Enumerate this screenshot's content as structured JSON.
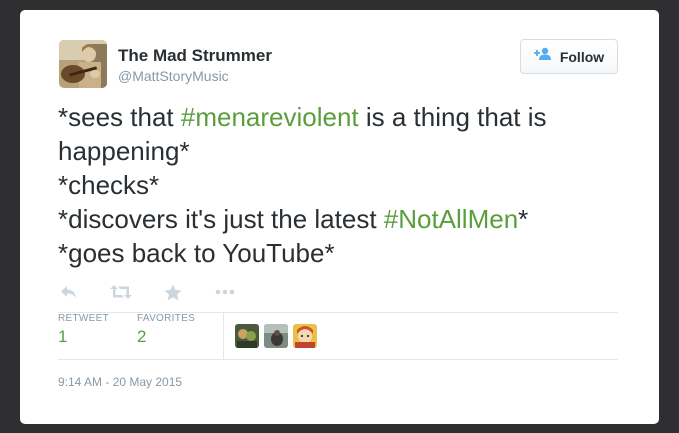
{
  "author": {
    "name": "The Mad Strummer",
    "handle": "@MattStoryMusic",
    "avatar_icon": "avatar-guitarist"
  },
  "follow_button": {
    "label": "Follow",
    "icon": "add-user-icon",
    "icon_color": "#55acee"
  },
  "tweet": {
    "lines": [
      [
        {
          "text": "*sees that ",
          "type": "text"
        },
        {
          "text": "#menareviolent",
          "type": "hashtag"
        },
        {
          "text": " is a thing that is",
          "type": "text"
        }
      ],
      [
        {
          "text": "happening*",
          "type": "text"
        }
      ],
      [
        {
          "text": "*checks*",
          "type": "text"
        }
      ],
      [
        {
          "text": "*discovers it's just the latest ",
          "type": "text"
        },
        {
          "text": "#NotAllMen",
          "type": "hashtag"
        },
        {
          "text": "*",
          "type": "text"
        }
      ],
      [
        {
          "text": "*goes back to YouTube*",
          "type": "text"
        }
      ]
    ],
    "hashtag_color": "#5a9e3c"
  },
  "actions": [
    {
      "name": "reply-icon"
    },
    {
      "name": "retweet-icon"
    },
    {
      "name": "favorite-star-icon"
    },
    {
      "name": "more-options-icon"
    }
  ],
  "stats": {
    "retweet_label": "RETWEET",
    "retweet_count": "1",
    "favorites_label": "FAVORITES",
    "favorites_count": "2"
  },
  "favoriters": [
    {
      "name": "favoriter-avatar-1"
    },
    {
      "name": "favoriter-avatar-2"
    },
    {
      "name": "favoriter-avatar-3"
    }
  ],
  "timestamp": "9:14 AM - 20 May 2015"
}
